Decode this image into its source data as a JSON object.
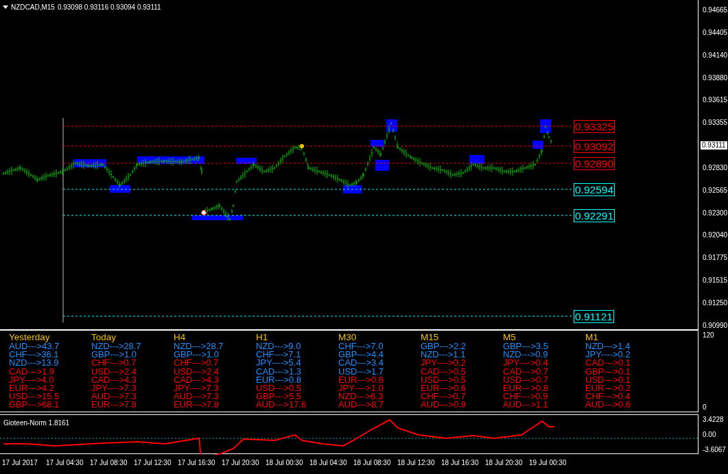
{
  "chart": {
    "symbol": "NZDCAD,M15",
    "quote": "0.93098 0.93116 0.93094 0.93111",
    "price_axis": [
      "0.94665",
      "0.94405",
      "0.94140",
      "0.93880",
      "0.93615",
      "0.93355",
      "0.92830",
      "0.92565",
      "0.92300",
      "0.92040",
      "0.91775",
      "0.91515",
      "0.91250",
      "0.90990"
    ],
    "current_price": "0.93111",
    "levels": [
      {
        "label": "0.93325",
        "color": "#ff0000"
      },
      {
        "label": "0.93092",
        "color": "#ff0000"
      },
      {
        "label": "0.92890",
        "color": "#ff0000"
      },
      {
        "label": "0.92594",
        "color": "#00ffff"
      },
      {
        "label": "0.92291",
        "color": "#00ffff"
      },
      {
        "label": "0.91121",
        "color": "#00ffff"
      }
    ]
  },
  "strength_table": {
    "columns": [
      {
        "title": "Yesterday",
        "rows": [
          {
            "text": "AUD--->43.7",
            "color": "#1e90ff"
          },
          {
            "text": "CHF--->36.1",
            "color": "#1e90ff"
          },
          {
            "text": "NZD--->13.9",
            "color": "#1e90ff"
          },
          {
            "text": "CAD--->1.9",
            "color": "#ff0000"
          },
          {
            "text": "JPY---->4.0",
            "color": "#ff0000"
          },
          {
            "text": "EUR--->4.2",
            "color": "#ff0000"
          },
          {
            "text": "USD--->15.5",
            "color": "#ff0000"
          },
          {
            "text": "GBP--->68.1",
            "color": "#ff0000"
          }
        ]
      },
      {
        "title": "Today",
        "rows": [
          {
            "text": "NZD--->28.7",
            "color": "#1e90ff"
          },
          {
            "text": "GBP--->1.0",
            "color": "#1e90ff"
          },
          {
            "text": "CHF--->0.7",
            "color": "#ff0000"
          },
          {
            "text": "USD--->2.4",
            "color": "#ff0000"
          },
          {
            "text": "CAD--->4.3",
            "color": "#ff0000"
          },
          {
            "text": "JPY---->7.3",
            "color": "#ff0000"
          },
          {
            "text": "AUD--->7.3",
            "color": "#ff0000"
          },
          {
            "text": "EUR--->7.8",
            "color": "#ff0000"
          }
        ]
      },
      {
        "title": "H4",
        "rows": [
          {
            "text": "NZD--->28.7",
            "color": "#1e90ff"
          },
          {
            "text": "GBP--->1.0",
            "color": "#1e90ff"
          },
          {
            "text": "CHF--->0.7",
            "color": "#ff0000"
          },
          {
            "text": "USD--->2.4",
            "color": "#ff0000"
          },
          {
            "text": "CAD--->4.3",
            "color": "#ff0000"
          },
          {
            "text": "JPY---->7.3",
            "color": "#ff0000"
          },
          {
            "text": "AUD--->7.3",
            "color": "#ff0000"
          },
          {
            "text": "EUR--->7.8",
            "color": "#ff0000"
          }
        ]
      },
      {
        "title": "H1",
        "rows": [
          {
            "text": "NZD--->9.0",
            "color": "#1e90ff"
          },
          {
            "text": "CHF--->7.1",
            "color": "#1e90ff"
          },
          {
            "text": "JPY---->5.4",
            "color": "#1e90ff"
          },
          {
            "text": "CAD--->1.3",
            "color": "#1e90ff"
          },
          {
            "text": "EUR--->0.8",
            "color": "#1e90ff"
          },
          {
            "text": "USD--->0.5",
            "color": "#ff0000"
          },
          {
            "text": "GBP--->5.5",
            "color": "#ff0000"
          },
          {
            "text": "AUD--->17.6",
            "color": "#ff0000"
          }
        ]
      },
      {
        "title": "M30",
        "rows": [
          {
            "text": "CHF--->7.0",
            "color": "#1e90ff"
          },
          {
            "text": "GBP--->4.4",
            "color": "#1e90ff"
          },
          {
            "text": "CAD--->3.4",
            "color": "#1e90ff"
          },
          {
            "text": "USD--->1.7",
            "color": "#1e90ff"
          },
          {
            "text": "EUR--->0.6",
            "color": "#ff0000"
          },
          {
            "text": "JPY---->1.0",
            "color": "#ff0000"
          },
          {
            "text": "NZD--->6.3",
            "color": "#ff0000"
          },
          {
            "text": "AUD--->8.7",
            "color": "#ff0000"
          }
        ]
      },
      {
        "title": "M15",
        "rows": [
          {
            "text": "GBP--->2.2",
            "color": "#1e90ff"
          },
          {
            "text": "NZD--->1.1",
            "color": "#1e90ff"
          },
          {
            "text": "JPY---->0.2",
            "color": "#ff0000"
          },
          {
            "text": "CAD--->0.5",
            "color": "#ff0000"
          },
          {
            "text": "USD--->0.5",
            "color": "#ff0000"
          },
          {
            "text": "EUR--->0.6",
            "color": "#ff0000"
          },
          {
            "text": "CHF--->0.7",
            "color": "#ff0000"
          },
          {
            "text": "AUD--->0.9",
            "color": "#ff0000"
          }
        ]
      },
      {
        "title": "M5",
        "rows": [
          {
            "text": "GBP--->3.5",
            "color": "#1e90ff"
          },
          {
            "text": "NZD--->0.9",
            "color": "#1e90ff"
          },
          {
            "text": "JPY---->0.4",
            "color": "#ff0000"
          },
          {
            "text": "CAD--->0.7",
            "color": "#ff0000"
          },
          {
            "text": "USD--->0.7",
            "color": "#ff0000"
          },
          {
            "text": "EUR--->0.8",
            "color": "#ff0000"
          },
          {
            "text": "CHF--->0.9",
            "color": "#ff0000"
          },
          {
            "text": "AUD--->1.1",
            "color": "#ff0000"
          }
        ]
      },
      {
        "title": "M1",
        "rows": [
          {
            "text": "NZD--->1.4",
            "color": "#1e90ff"
          },
          {
            "text": "JPY---->0.2",
            "color": "#1e90ff"
          },
          {
            "text": "CAD--->0.1",
            "color": "#ff0000"
          },
          {
            "text": "GBP--->0.1",
            "color": "#ff0000"
          },
          {
            "text": "USD--->0.1",
            "color": "#ff0000"
          },
          {
            "text": "EUR--->0.2",
            "color": "#ff0000"
          },
          {
            "text": "CHF--->0.4",
            "color": "#ff0000"
          },
          {
            "text": "AUD--->0.6",
            "color": "#ff0000"
          }
        ]
      }
    ],
    "axis": [
      "120",
      "0"
    ]
  },
  "indicator": {
    "title": "Gioteen-Norm 1.8161",
    "axis": [
      "3.4228",
      "0.00",
      "-3.6067"
    ]
  },
  "time_axis": [
    "17 Jul 2017",
    "17 Jul 04:30",
    "17 Jul 08:30",
    "17 Jul 12:30",
    "17 Jul 16:30",
    "17 Jul 20:30",
    "18 Jul 00:30",
    "18 Jul 04:30",
    "18 Jul 08:30",
    "18 Jul 12:30",
    "18 Jul 16:30",
    "18 Jul 20:30",
    "19 Jul 00:30"
  ]
}
